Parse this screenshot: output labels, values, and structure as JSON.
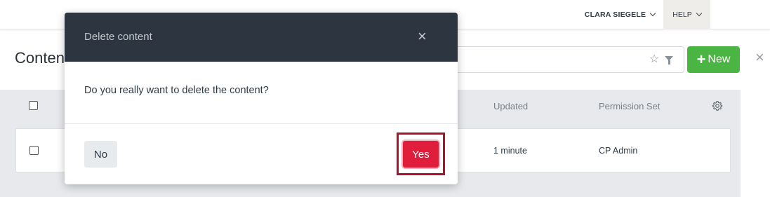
{
  "topbar": {
    "user_name": "CLARA SIEGELE",
    "help_label": "HELP"
  },
  "page": {
    "title": "Content",
    "new_label": "New",
    "close_glyph": "×"
  },
  "table": {
    "columns": {
      "col2": "Updated",
      "col3": "Permission Set"
    },
    "rows": [
      {
        "updated": "1 minute",
        "permission_set": "CP Admin"
      }
    ]
  },
  "modal": {
    "title": "Delete content",
    "message": "Do you really want to delete the content?",
    "no_label": "No",
    "yes_label": "Yes",
    "close_glyph": "×"
  },
  "colors": {
    "modal_header": "#2d3640",
    "new_button": "#4bb543",
    "yes_button": "#e01e3c",
    "highlight_outline": "#a8122c"
  },
  "icons": [
    "chevron-down-icon",
    "star-icon",
    "filter-icon",
    "plus-icon",
    "close-icon",
    "gear-icon"
  ]
}
